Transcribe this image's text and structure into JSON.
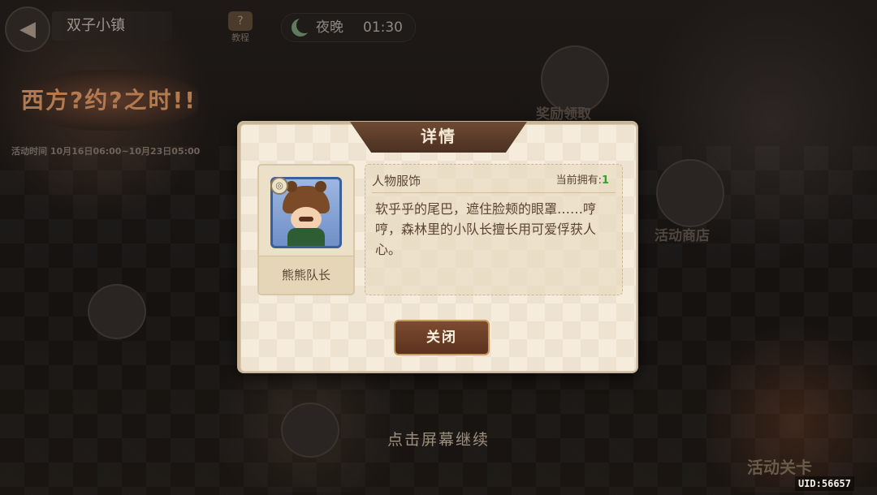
{
  "top_bar": {
    "back_icon": "back-arrow-icon",
    "town_title": "双子小镇",
    "tutorial_label": "教程",
    "time_of_day": "夜晚",
    "clock": "01:30"
  },
  "event": {
    "banner_text": "西方?约?之时!!",
    "time_range": "活动时间 10月16日06:00~10月23日05:00"
  },
  "side_labels": {
    "reward": "奖励领取",
    "shop": "活动商店",
    "stage": "活动关卡"
  },
  "dialog": {
    "title": "详情",
    "item_name": "熊熊队长",
    "category": "人物服饰",
    "owned_label": "当前拥有:",
    "owned_count": "1",
    "description": "软乎乎的尾巴，遮住脸颊的眼罩……哼哼，森林里的小队长擅长用可爱俘获人心。",
    "close_label": "关闭"
  },
  "footer": {
    "tap_continue": "点击屏幕继续",
    "uid": "UID:56657"
  }
}
